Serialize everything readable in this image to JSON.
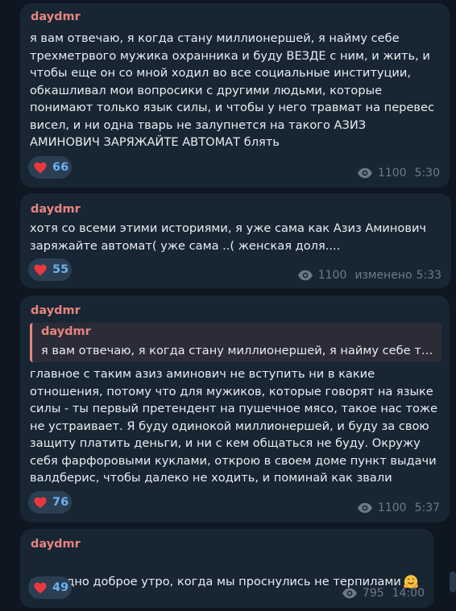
{
  "messages": [
    {
      "author": "daydmr",
      "text": "я вам отвечаю, я когда стану миллионершей, я найму себе\nтрехметрвого мужика охранника и буду ВЕЗДЕ с ним, и жить, и\nчтобы еще он со мной ходил во все социальные институции,\nобкашливал мои вопросики с другими людьми, которые\nпонимают только язык силы, и чтобы у него травмат на перевес\nвисел, и ни одна тварь не залупнется на такого АЗИЗ\nАМИНОВИЧ ЗАРЯЖАЙТЕ АВТОМАТ блять",
      "reaction_count": "66",
      "views": "1100",
      "edited": "",
      "time": "5:30"
    },
    {
      "author": "daydmr",
      "text": "хотя со всеми этими историями, я уже сама как Азиз Аминович\nзаряжайте автомат( уже сама ..( женская доля....",
      "reaction_count": "55",
      "views": "1100",
      "edited": "изменено",
      "time": "5:33"
    },
    {
      "author": "daydmr",
      "reply": {
        "author": "daydmr",
        "text": "я вам отвечаю, я когда стану миллионершей, я найму себе трехметрвого мужика охранника"
      },
      "text": "главное с таким азиз аминович не вступить ни в какие\nотношения, потому что для мужиков, которые говорят на языке\nсилы - ты первый претендент на пушечное мясо, такое нас тоже\nне устраивает. Я буду одинокой миллионершей, и буду за свою\nзащиту платить деньги, и ни с кем общаться не буду. Окружу\nсебя фарфоровыми куклами, открою в своем доме пункт выдачи\nвалдберис, чтобы далеко не ходить, и поминай как звали",
      "reaction_count": "76",
      "views": "1100",
      "edited": "",
      "time": "5:37"
    },
    {
      "author": "daydmr",
      "text": "еще одно доброе утро, когда мы проснулись не терпилами",
      "emoji": "hugging-face-emoji",
      "reaction_count": "49",
      "views": "795",
      "edited": "",
      "time": "14:00"
    }
  ],
  "colors": {
    "background": "#0e1621",
    "bubble": "#182533",
    "author": "#e5857e",
    "reaction_bg": "#2b3e52",
    "reaction_count": "#6ab2f2",
    "meta": "#6e7a88",
    "heart": "#e8393f"
  },
  "icons": {
    "reaction": "heart-icon",
    "views": "eye-icon"
  }
}
